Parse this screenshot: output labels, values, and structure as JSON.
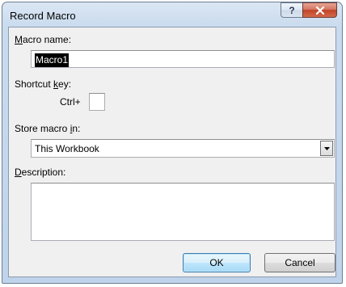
{
  "window": {
    "title": "Record Macro",
    "help_glyph": "?"
  },
  "macro_name": {
    "label_accel": "M",
    "label_rest": "acro name:",
    "value": "Macro1"
  },
  "shortcut_key": {
    "label_pre": "Shortcut ",
    "label_accel": "k",
    "label_post": "ey:",
    "prefix": "Ctrl+",
    "value": ""
  },
  "store_in": {
    "label_pre": "Store macro ",
    "label_accel": "i",
    "label_post": "n:",
    "selected": "This Workbook"
  },
  "description": {
    "label_accel": "D",
    "label_rest": "escription:",
    "value": ""
  },
  "buttons": {
    "ok": "OK",
    "cancel": "Cancel"
  },
  "icons": {
    "help": "help-icon",
    "close": "close-icon",
    "dropdown": "dropdown-arrow-icon"
  }
}
